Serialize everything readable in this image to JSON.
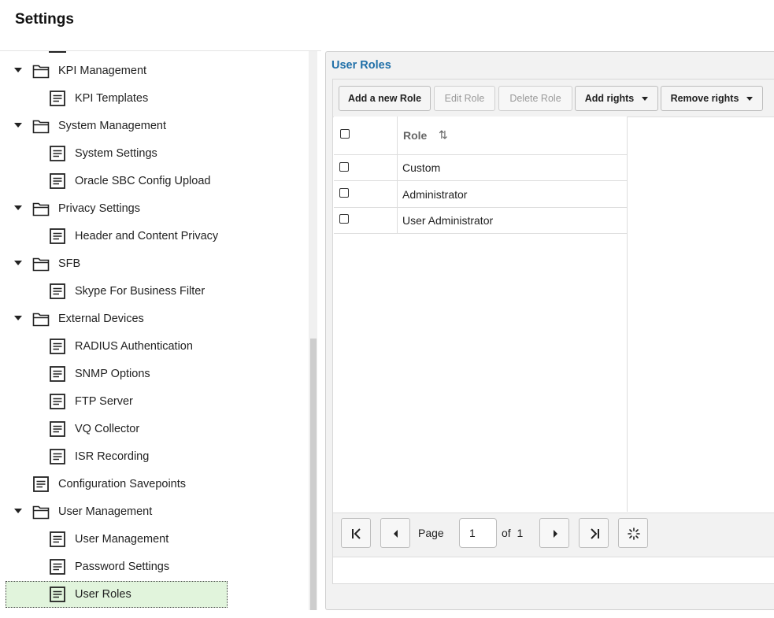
{
  "header": {
    "title": "Settings"
  },
  "sidebar": {
    "items": [
      {
        "label": "KPI Management",
        "type": "folder",
        "level": 0,
        "expanded": true
      },
      {
        "label": "KPI Templates",
        "type": "page",
        "level": 1
      },
      {
        "label": "System Management",
        "type": "folder",
        "level": 0,
        "expanded": true
      },
      {
        "label": "System Settings",
        "type": "page",
        "level": 1
      },
      {
        "label": "Oracle SBC Config Upload",
        "type": "page",
        "level": 1
      },
      {
        "label": "Privacy Settings",
        "type": "folder",
        "level": 0,
        "expanded": true
      },
      {
        "label": "Header and Content Privacy",
        "type": "page",
        "level": 1
      },
      {
        "label": "SFB",
        "type": "folder",
        "level": 0,
        "expanded": true
      },
      {
        "label": "Skype For Business Filter",
        "type": "page",
        "level": 1
      },
      {
        "label": "External Devices",
        "type": "folder",
        "level": 0,
        "expanded": true
      },
      {
        "label": "RADIUS Authentication",
        "type": "page",
        "level": 1
      },
      {
        "label": "SNMP Options",
        "type": "page",
        "level": 1
      },
      {
        "label": "FTP Server",
        "type": "page",
        "level": 1
      },
      {
        "label": "VQ Collector",
        "type": "page",
        "level": 1
      },
      {
        "label": "ISR Recording",
        "type": "page",
        "level": 1
      },
      {
        "label": "Configuration Savepoints",
        "type": "page",
        "level": 0
      },
      {
        "label": "User Management",
        "type": "folder",
        "level": 0,
        "expanded": true
      },
      {
        "label": "User Management",
        "type": "page",
        "level": 1
      },
      {
        "label": "Password Settings",
        "type": "page",
        "level": 1
      },
      {
        "label": "User Roles",
        "type": "page",
        "level": 1,
        "selected": true
      }
    ]
  },
  "main": {
    "title": "User Roles",
    "toolbar": {
      "add_role": "Add a new Role",
      "edit_role": "Edit Role",
      "delete_role": "Delete Role",
      "add_rights": "Add rights",
      "remove_rights": "Remove rights"
    },
    "grid": {
      "column_header": "Role",
      "rows": [
        "Custom",
        "Administrator",
        "User Administrator"
      ]
    },
    "pager": {
      "page_label": "Page",
      "current_page": "1",
      "of_label": "of",
      "total_pages": "1"
    }
  },
  "colors": {
    "accent_title": "#1f6fa8",
    "selected_row": "#e1f4dc"
  }
}
